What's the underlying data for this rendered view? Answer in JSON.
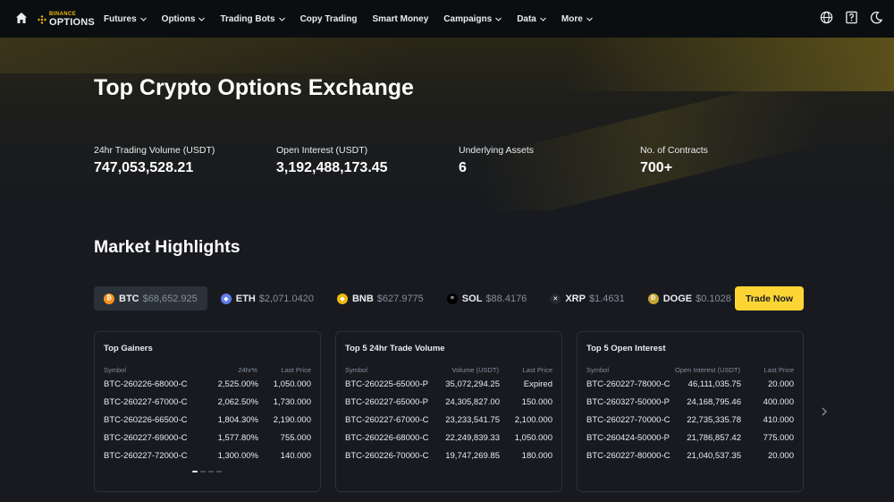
{
  "nav": {
    "logo_top": "BINANCE",
    "logo_bottom": "OPTIONS",
    "items": [
      {
        "label": "Futures",
        "dropdown": true
      },
      {
        "label": "Options",
        "dropdown": true
      },
      {
        "label": "Trading Bots",
        "dropdown": true
      },
      {
        "label": "Copy Trading",
        "dropdown": false
      },
      {
        "label": "Smart Money",
        "dropdown": false
      },
      {
        "label": "Campaigns",
        "dropdown": true
      },
      {
        "label": "Data",
        "dropdown": true
      },
      {
        "label": "More",
        "dropdown": true
      }
    ],
    "right_icons": [
      "globe-icon",
      "help-icon",
      "moon-icon"
    ]
  },
  "hero": {
    "title": "Top Crypto Options Exchange",
    "stats": [
      {
        "label": "24hr Trading Volume (USDT)",
        "value": "747,053,528.21"
      },
      {
        "label": "Open Interest (USDT)",
        "value": "3,192,488,173.45"
      },
      {
        "label": "Underlying Assets",
        "value": "6"
      },
      {
        "label": "No. of Contracts",
        "value": "700+"
      }
    ]
  },
  "market": {
    "title": "Market Highlights",
    "trade_now": "Trade Now",
    "tabs": [
      {
        "symbol": "BTC",
        "price": "$68,652.925",
        "color": "#f7931a",
        "glyph": "₿",
        "active": true
      },
      {
        "symbol": "ETH",
        "price": "$2,071.0420",
        "color": "#627eea",
        "glyph": "◆",
        "active": false
      },
      {
        "symbol": "BNB",
        "price": "$627.9775",
        "color": "#f0b90b",
        "glyph": "◆",
        "active": false
      },
      {
        "symbol": "SOL",
        "price": "$88.4176",
        "color": "#000000",
        "glyph": "≡",
        "active": false
      },
      {
        "symbol": "XRP",
        "price": "$1.4631",
        "color": "#23292f",
        "glyph": "✕",
        "active": false
      },
      {
        "symbol": "DOGE",
        "price": "$0.1028",
        "color": "#c2a633",
        "glyph": "Ð",
        "active": false
      }
    ],
    "cards": [
      {
        "title": "Top Gainers",
        "headers": [
          "Symbol",
          "24hr%",
          "Last Price"
        ],
        "rows": [
          [
            "BTC-260226-68000-C",
            "2,525.00%",
            "1,050.000"
          ],
          [
            "BTC-260227-67000-C",
            "2,062.50%",
            "1,730.000"
          ],
          [
            "BTC-260226-66500-C",
            "1,804.30%",
            "2,190.000"
          ],
          [
            "BTC-260227-69000-C",
            "1,577.80%",
            "755.000"
          ],
          [
            "BTC-260227-72000-C",
            "1,300.00%",
            "140.000"
          ]
        ]
      },
      {
        "title": "Top 5 24hr Trade Volume",
        "headers": [
          "Symbol",
          "Volume (USDT)",
          "Last Price"
        ],
        "rows": [
          [
            "BTC-260225-65000-P",
            "35,072,294.25",
            "Expired"
          ],
          [
            "BTC-260227-65000-P",
            "24,305,827.00",
            "150.000"
          ],
          [
            "BTC-260227-67000-C",
            "23,233,541.75",
            "2,100.000"
          ],
          [
            "BTC-260226-68000-C",
            "22,249,839.33",
            "1,050.000"
          ],
          [
            "BTC-260226-70000-C",
            "19,747,269.85",
            "180.000"
          ]
        ]
      },
      {
        "title": "Top 5 Open Interest",
        "headers": [
          "Symbol",
          "Open Interest (USDT)",
          "Last Price"
        ],
        "rows": [
          [
            "BTC-260227-78000-C",
            "46,111,035.75",
            "20.000"
          ],
          [
            "BTC-260327-50000-P",
            "24,168,795.46",
            "400.000"
          ],
          [
            "BTC-260227-70000-C",
            "22,735,335.78",
            "410.000"
          ],
          [
            "BTC-260424-50000-P",
            "21,786,857.42",
            "775.000"
          ],
          [
            "BTC-260227-80000-C",
            "21,040,537.35",
            "20.000"
          ]
        ]
      }
    ]
  }
}
